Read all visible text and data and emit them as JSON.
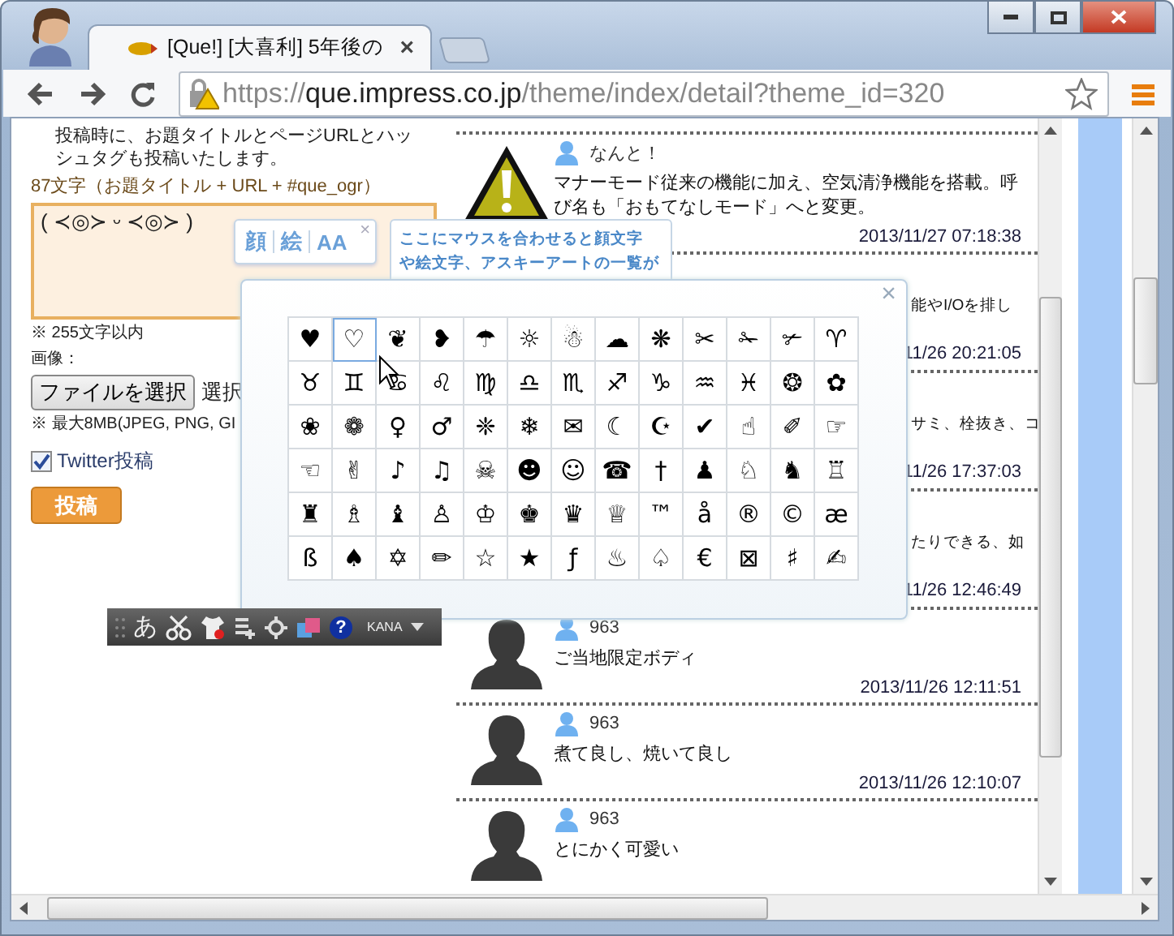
{
  "browser": {
    "tabs": [
      {
        "title": "[Que!] [大喜利] 5年後の",
        "selected": true,
        "close": "×"
      }
    ],
    "url": {
      "scheme": "https://",
      "host": "que.impress.co.jp",
      "path": "/theme/index/detail?theme_id=320"
    }
  },
  "form": {
    "notice": "投稿時に、お題タイトルとページURLとハッシュタグも投稿いたします。",
    "char_count": "87文字（お題タイトル + URL +  #que_ogr）",
    "message": {
      "value": "( ≺◎≻ ᵕ ≺◎≻ )"
    },
    "limit_note": "※ 255文字以内",
    "image_label": "画像：",
    "file_button": "ファイルを選択",
    "file_status": "選択",
    "size_note": "※ 最大8MB(JPEG, PNG, GI",
    "twitter": {
      "label": "Twitter投稿",
      "checked": true
    },
    "submit": "投稿"
  },
  "ime_toolbar": {
    "mode": "あ",
    "help": "?",
    "input": "KANA"
  },
  "helper": {
    "tabs": [
      "顔",
      "絵",
      "AA"
    ],
    "close": "×",
    "hint_lines": [
      "ここにマウスを合わせると顔文字",
      "や絵文字、アスキーアートの一覧が"
    ]
  },
  "emoji_picker": {
    "close": "×",
    "rows": [
      {
        "cells": [
          {
            "c": "♥",
            "selected": false
          },
          {
            "c": "♡",
            "selected": true
          },
          {
            "c": "❦",
            "selected": false
          },
          {
            "c": "❥",
            "selected": false
          },
          {
            "c": "☂",
            "selected": false
          },
          {
            "c": "☼",
            "selected": false
          },
          {
            "c": "☃",
            "selected": false
          },
          {
            "c": "☁",
            "selected": false
          },
          {
            "c": "❋",
            "selected": false
          },
          {
            "c": "✂",
            "selected": false
          },
          {
            "c": "✁",
            "selected": false
          },
          {
            "c": "✃",
            "selected": false
          },
          {
            "c": "♈",
            "selected": false
          }
        ]
      },
      {
        "cells": [
          {
            "c": "♉",
            "selected": false
          },
          {
            "c": "♊",
            "selected": false
          },
          {
            "c": "♋",
            "selected": false
          },
          {
            "c": "♌",
            "selected": false
          },
          {
            "c": "♍",
            "selected": false
          },
          {
            "c": "♎",
            "selected": false
          },
          {
            "c": "♏",
            "selected": false
          },
          {
            "c": "♐",
            "selected": false
          },
          {
            "c": "♑",
            "selected": false
          },
          {
            "c": "♒",
            "selected": false
          },
          {
            "c": "♓",
            "selected": false
          },
          {
            "c": "❂",
            "selected": false
          },
          {
            "c": "✿",
            "selected": false
          }
        ]
      },
      {
        "cells": [
          {
            "c": "❀",
            "selected": false
          },
          {
            "c": "❁",
            "selected": false
          },
          {
            "c": "♀",
            "selected": false
          },
          {
            "c": "♂",
            "selected": false
          },
          {
            "c": "❈",
            "selected": false
          },
          {
            "c": "❄",
            "selected": false
          },
          {
            "c": "✉",
            "selected": false
          },
          {
            "c": "☾",
            "selected": false
          },
          {
            "c": "☪",
            "selected": false
          },
          {
            "c": "✔",
            "selected": false
          },
          {
            "c": "☝",
            "selected": false
          },
          {
            "c": "✐",
            "selected": false
          },
          {
            "c": "☞",
            "selected": false
          }
        ]
      },
      {
        "cells": [
          {
            "c": "☜",
            "selected": false
          },
          {
            "c": "✌",
            "selected": false
          },
          {
            "c": "♪",
            "selected": false
          },
          {
            "c": "♫",
            "selected": false
          },
          {
            "c": "☠",
            "selected": false
          },
          {
            "c": "☻",
            "selected": false
          },
          {
            "c": "☺",
            "selected": false
          },
          {
            "c": "☎",
            "selected": false
          },
          {
            "c": "†",
            "selected": false
          },
          {
            "c": "♟",
            "selected": false
          },
          {
            "c": "♘",
            "selected": false
          },
          {
            "c": "♞",
            "selected": false
          },
          {
            "c": "♖",
            "selected": false
          }
        ]
      },
      {
        "cells": [
          {
            "c": "♜",
            "selected": false
          },
          {
            "c": "♗",
            "selected": false
          },
          {
            "c": "♝",
            "selected": false
          },
          {
            "c": "♙",
            "selected": false
          },
          {
            "c": "♔",
            "selected": false
          },
          {
            "c": "♚",
            "selected": false
          },
          {
            "c": "♛",
            "selected": false
          },
          {
            "c": "♕",
            "selected": false
          },
          {
            "c": "™",
            "selected": false
          },
          {
            "c": "å",
            "selected": false
          },
          {
            "c": "®",
            "selected": false
          },
          {
            "c": "©",
            "selected": false
          },
          {
            "c": "æ",
            "selected": false
          }
        ]
      },
      {
        "cells": [
          {
            "c": "ß",
            "selected": false
          },
          {
            "c": "♠",
            "selected": false
          },
          {
            "c": "✡",
            "selected": false
          },
          {
            "c": "✏",
            "selected": false
          },
          {
            "c": "☆",
            "selected": false
          },
          {
            "c": "★",
            "selected": false
          },
          {
            "c": "ƒ",
            "selected": false
          },
          {
            "c": "♨",
            "selected": false
          },
          {
            "c": "♤",
            "selected": false
          },
          {
            "c": "€",
            "selected": false
          },
          {
            "c": "⊠",
            "selected": false
          },
          {
            "c": "♯",
            "selected": false
          },
          {
            "c": "✍",
            "selected": false
          }
        ]
      }
    ]
  },
  "comments": [
    {
      "kind": "alert",
      "user": "なんと！",
      "text": "マナーモード従来の機能に加え、空気清浄機能を搭載。呼び名も「おもてなしモード」へと変更。",
      "time": "2013/11/27 07:18:38"
    },
    {
      "kind": "partial",
      "text": "能やI/Oを排し",
      "time": "11/26 20:21:05"
    },
    {
      "kind": "partial",
      "text": "サミ、栓抜き、コ",
      "time": "11/26 17:37:03"
    },
    {
      "kind": "partial",
      "text": "たりできる、如",
      "time": "11/26 12:46:49"
    },
    {
      "kind": "member",
      "user": "963",
      "text": "ご当地限定ボディ",
      "time": "2013/11/26 12:11:51"
    },
    {
      "kind": "member",
      "user": "963",
      "text": "煮て良し、焼いて良し",
      "time": "2013/11/26 12:10:07"
    },
    {
      "kind": "member",
      "user": "963",
      "text": "とにかく可愛い"
    }
  ]
}
